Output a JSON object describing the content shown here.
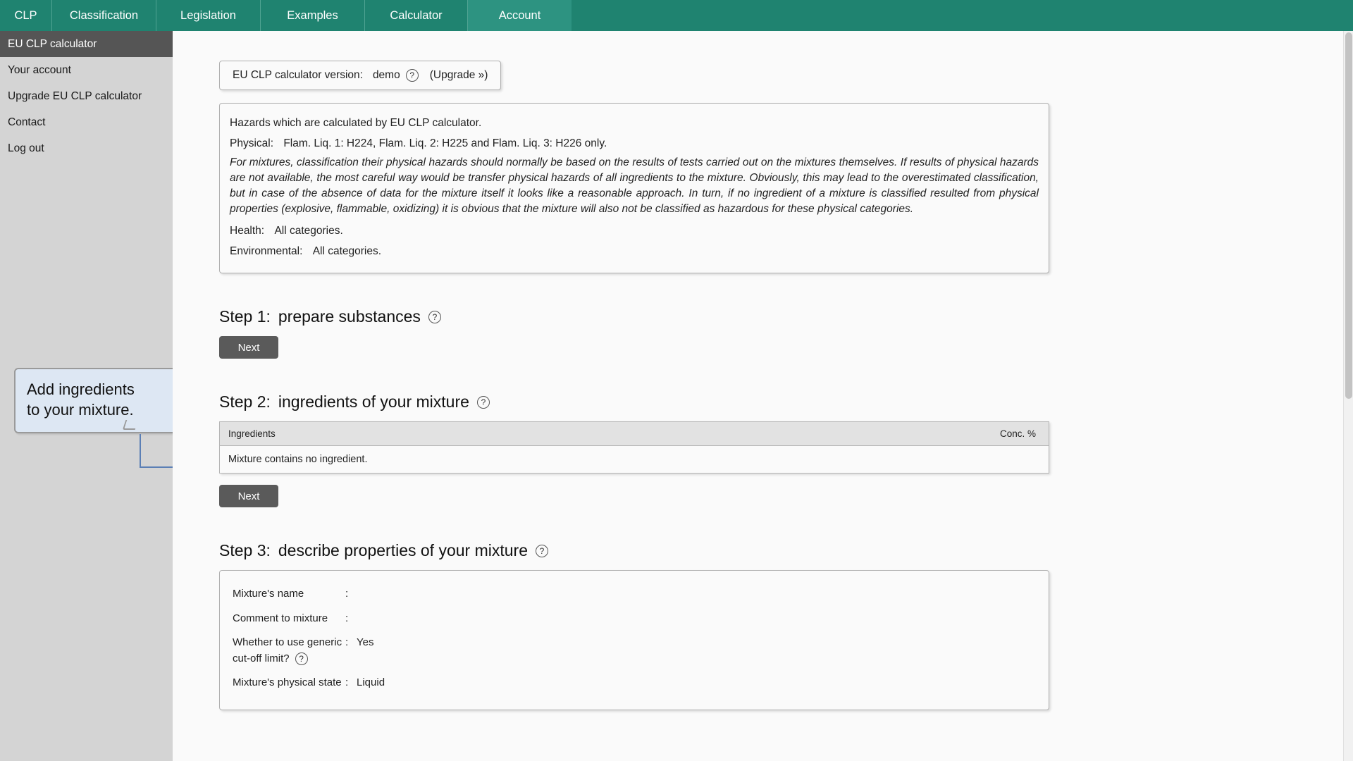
{
  "topnav": {
    "items": [
      {
        "label": "CLP",
        "active": false
      },
      {
        "label": "Classification",
        "active": false
      },
      {
        "label": "Legislation",
        "active": false
      },
      {
        "label": "Examples",
        "active": false
      },
      {
        "label": "Calculator",
        "active": false
      },
      {
        "label": "Account",
        "active": true
      }
    ]
  },
  "sidebar": {
    "items": [
      {
        "label": "EU CLP calculator",
        "active": true
      },
      {
        "label": "Your account",
        "active": false
      },
      {
        "label": "Upgrade EU CLP calculator",
        "active": false
      },
      {
        "label": "Contact",
        "active": false
      },
      {
        "label": "Log out",
        "active": false
      }
    ],
    "callout": {
      "line1": "Add ingredients",
      "line2": "to your mixture."
    }
  },
  "version": {
    "label": "EU CLP calculator version:",
    "value": "demo",
    "help_icon": "?",
    "upgrade_link": "(Upgrade »)"
  },
  "hazards": {
    "intro": "Hazards which are calculated by EU CLP calculator.",
    "physical_label": "Physical:",
    "physical_value": "Flam. Liq. 1: H224, Flam. Liq. 2: H225 and Flam. Liq. 3: H226 only.",
    "note": "For mixtures, classification their physical hazards should normally be based on the results of tests carried out on the mixtures themselves. If results of physical hazards are not available, the most careful way would be transfer physical hazards of all ingredients to the mixture. Obviously, this may lead to the overestimated classification, but in case of the absence of data for the mixture itself it looks like a reasonable approach. In turn, if no ingredient of a mixture is classified resulted from physical properties (explosive, flammable, oxidizing) it is obvious that the mixture will also not be classified as hazardous for these physical categories.",
    "health_label": "Health:",
    "health_value": "All categories.",
    "environmental_label": "Environmental:",
    "environmental_value": "All categories."
  },
  "step1": {
    "num": "Step 1:",
    "title": "prepare substances",
    "help_icon": "?",
    "next_label": "Next"
  },
  "step2": {
    "num": "Step 2:",
    "title": "ingredients of your mixture",
    "help_icon": "?",
    "next_label": "Next",
    "table": {
      "columns": [
        "Ingredients",
        "Conc. %"
      ],
      "empty_message": "Mixture contains no ingredient."
    }
  },
  "step3": {
    "num": "Step 3:",
    "title": "describe properties of your mixture",
    "help_icon": "?",
    "properties": [
      {
        "label": "Mixture's name",
        "colon": ":",
        "value": ""
      },
      {
        "label": "Comment to mixture",
        "colon": ":",
        "value": ""
      },
      {
        "label": "Whether to use generic",
        "label2": "cut-off limit?",
        "colon": ":",
        "value": "Yes",
        "help_icon": "?"
      },
      {
        "label": "Mixture's physical state",
        "colon": ":",
        "value": "Liquid"
      }
    ]
  },
  "colors": {
    "nav_green": "#1f8370",
    "nav_active_green": "#2d9381",
    "sidebar_gray": "#d4d4d4",
    "sidebar_active": "#555555",
    "button_gray": "#5a5a5a",
    "callout_blue": "#dde7f3",
    "arrow_blue": "#5b7fb5"
  }
}
